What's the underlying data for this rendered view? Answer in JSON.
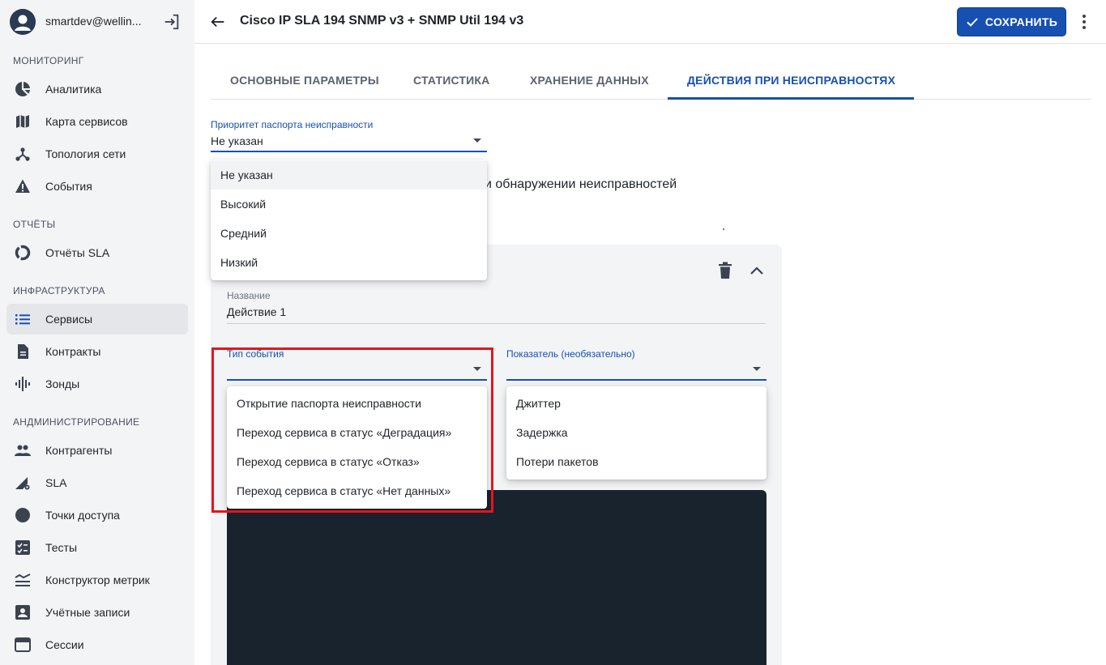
{
  "user": {
    "email": "smartdev@wellin..."
  },
  "sidebar": {
    "sections": [
      {
        "label": "МОНИТОРИНГ"
      },
      {
        "label": "ОТЧЁТЫ"
      },
      {
        "label": "ИНФРАСТРУКТУРА"
      },
      {
        "label": "АНДМИНИСТРИРОВАНИЕ"
      }
    ],
    "items": [
      {
        "label": "Аналитика",
        "icon": "pie-chart-icon"
      },
      {
        "label": "Карта сервисов",
        "icon": "map-icon"
      },
      {
        "label": "Топология сети",
        "icon": "topology-icon"
      },
      {
        "label": "События",
        "icon": "warning-icon"
      },
      {
        "label": "Отчёты SLA",
        "icon": "donut-icon"
      },
      {
        "label": "Сервисы",
        "icon": "list-icon",
        "active": true
      },
      {
        "label": "Контракты",
        "icon": "document-icon"
      },
      {
        "label": "Зонды",
        "icon": "waveform-icon"
      },
      {
        "label": "Контрагенты",
        "icon": "people-icon"
      },
      {
        "label": "SLA",
        "icon": "signal-gear-icon"
      },
      {
        "label": "Точки доступа",
        "icon": "circle-icon"
      },
      {
        "label": "Тесты",
        "icon": "checklist-icon"
      },
      {
        "label": "Конструктор метрик",
        "icon": "metrics-icon"
      },
      {
        "label": "Учётные записи",
        "icon": "account-icon"
      },
      {
        "label": "Сессии",
        "icon": "window-icon"
      }
    ]
  },
  "header": {
    "title": "Cisco IP SLA 194 SNMP v3 + SNMP Util 194 v3",
    "save_label": "СОХРАНИТЬ"
  },
  "tabs": [
    {
      "label": "ОСНОВНЫЕ ПАРАМЕТРЫ"
    },
    {
      "label": "СТАТИСТИКА"
    },
    {
      "label": "ХРАНЕНИЕ ДАННЫХ"
    },
    {
      "label": "ДЕЙСТВИЯ ПРИ НЕИСПРАВНОСТЯХ",
      "active": true
    }
  ],
  "priority": {
    "label": "Приоритет паспорта неисправности",
    "value": "Не указан",
    "options": [
      "Не указан",
      "Высокий",
      "Средний",
      "Низкий"
    ]
  },
  "background_text": "и обнаружении неисправностей",
  "action": {
    "name_label": "Название",
    "name_value": "Действие 1",
    "event_type": {
      "label": "Тип события",
      "options": [
        "Открытие паспорта неисправности",
        "Переход сервиса в статус «Деградация»",
        "Переход сервиса в статус «Отказ»",
        "Переход сервиса в статус «Нет данных»"
      ]
    },
    "indicator": {
      "label": "Показатель (необязательно)",
      "options": [
        "Джиттер",
        "Задержка",
        "Потери пакетов"
      ]
    }
  },
  "colors": {
    "accent": "#1650b0",
    "highlight": "#e6141c",
    "sidebar_bg": "#f3f4f6",
    "dark_block": "#18232e"
  }
}
